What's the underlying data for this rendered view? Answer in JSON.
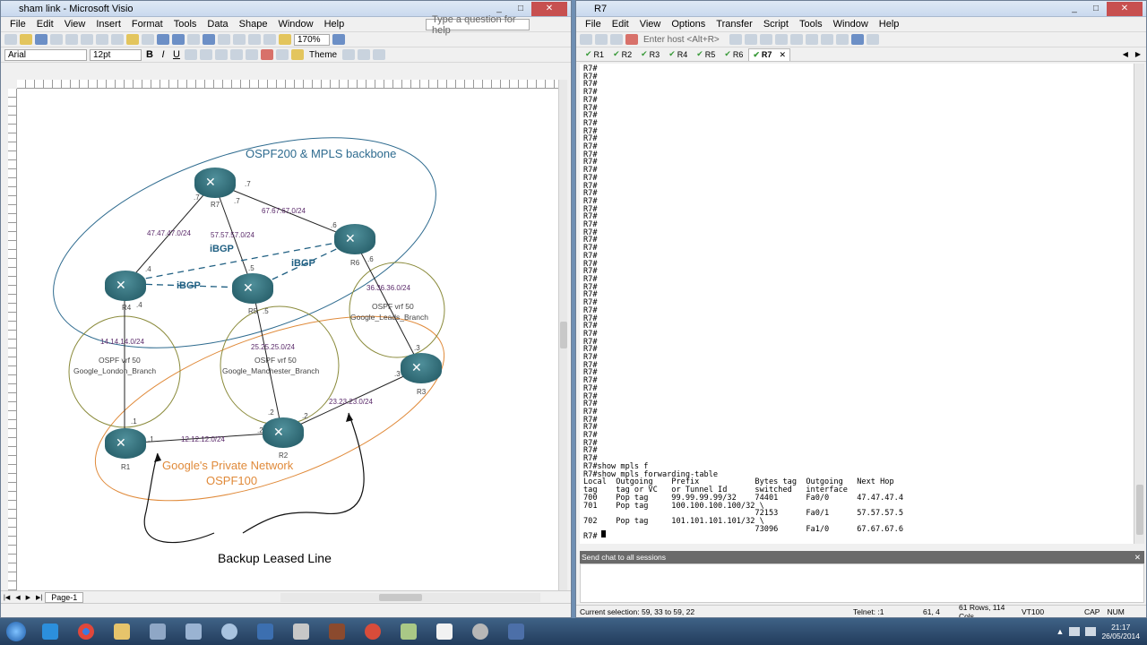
{
  "visio": {
    "title": "sham link - Microsoft Visio",
    "menu": [
      "File",
      "Edit",
      "View",
      "Insert",
      "Format",
      "Tools",
      "Data",
      "Shape",
      "Window",
      "Help"
    ],
    "help_placeholder": "Type a question for help",
    "zoom": "170%",
    "font": "Arial",
    "font_size": "12pt",
    "theme_label": "Theme",
    "page_tab": "Page-1",
    "diagram": {
      "backbone_title": "OSPF200 & MPLS backbone",
      "network_title": "Google's Private Network",
      "network_sub": "OSPF100",
      "backup_label": "Backup Leased Line",
      "routers": [
        "R7",
        "R6",
        "R4",
        "R5",
        "R3",
        "R1",
        "R2"
      ],
      "links": [
        "47.47.47.0/24",
        "57.57.57.0/24",
        "67.67.67.0/24",
        "14.14.14.0/24",
        "25.25.25.0/24",
        "36.36.36.0/24",
        "12.12.12.0/24",
        "23.23.23.0/24"
      ],
      "ibgp": [
        "iBGP",
        "iBGP",
        "iBGP"
      ],
      "sites": [
        {
          "vrf": "OSPF vrf 50",
          "name": "Google_London_Branch"
        },
        {
          "vrf": "OSPF vrf 50",
          "name": "Google_Manchester_Branch"
        },
        {
          "vrf": "OSPF vrf 50",
          "name": "Google_Leads_Branch"
        }
      ],
      "ifaces": {
        "r7_a": ".7",
        "r7_b": ".7",
        "r7_c": ".7",
        "r6_a": ".6",
        "r6_b": ".6",
        "r4_a": ".4",
        "r4_b": ".4",
        "r5_a": ".5",
        "r5_b": ".5",
        "r3_a": ".3",
        "r3_b": ".3",
        "r1_a": ".1",
        "r1_b": ".1",
        "r2_a": ".2",
        "r2_b": ".2",
        "r2_c": ".2"
      }
    }
  },
  "securecrt": {
    "title": "R7",
    "menu": [
      "File",
      "Edit",
      "View",
      "Options",
      "Transfer",
      "Script",
      "Tools",
      "Window",
      "Help"
    ],
    "host_placeholder": "Enter host <Alt+R>",
    "tabs": [
      "R1",
      "R2",
      "R3",
      "R4",
      "R5",
      "R6",
      "R7"
    ],
    "active_tab": "R7",
    "prompt_lines": 51,
    "prompt": "R7#",
    "output": [
      "R7#show mpls f",
      "R7#show mpls forwarding-table",
      "Local  Outgoing    Prefix            Bytes tag  Outgoing   Next Hop",
      "tag    tag or VC   or Tunnel Id      switched   interface",
      "700    Pop tag     99.99.99.99/32    74401      Fa0/0      47.47.47.4",
      "701    Pop tag     100.100.100.100/32 \\",
      "                                     72153      Fa0/1      57.57.57.5",
      "702    Pop tag     101.101.101.101/32 \\",
      "                                     73096      Fa1/0      67.67.67.6",
      "R7#"
    ],
    "chat_label": "Send chat to all sessions",
    "status": {
      "selection": "Current selection: 59, 33 to 59, 22",
      "protocol": "Telnet: :1",
      "position": "61,  4",
      "size": "61 Rows, 114 Cols",
      "emulation": "VT100",
      "caps": "CAP",
      "num": "NUM"
    }
  },
  "taskbar": {
    "time": "21:17",
    "date": "26/05/2014"
  },
  "colors": {
    "backbone": "#2e6b8f",
    "private": "#e08a3a",
    "site": "#8a8a3a",
    "link_label": "#5a2a6a",
    "ibgp": "#1f5f82"
  }
}
